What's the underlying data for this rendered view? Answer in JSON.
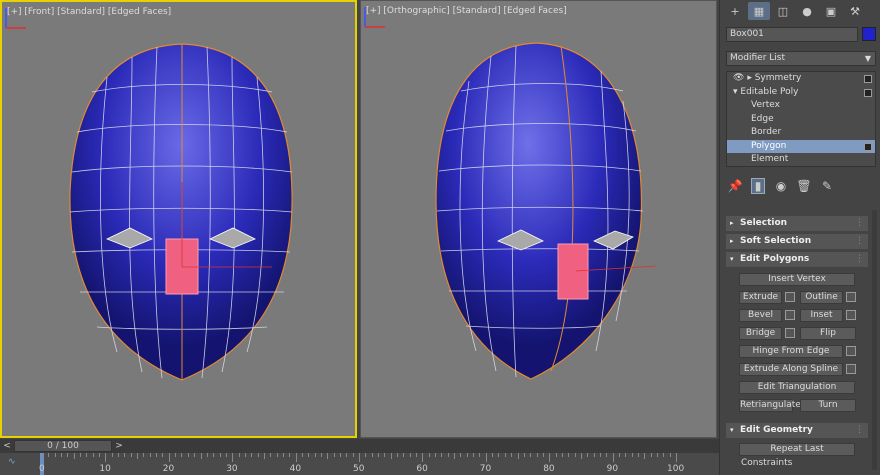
{
  "viewports": {
    "front": {
      "label": "[+] [Front] [Standard] [Edged Faces]"
    },
    "ortho": {
      "label": "[+] [Orthographic] [Standard] [Edged Faces]"
    }
  },
  "axis": {
    "z": "z",
    "x": "x"
  },
  "command_panel": {
    "tabs": [
      "create-icon",
      "modify-icon",
      "hierarchy-icon",
      "motion-icon",
      "display-icon",
      "utilities-icon"
    ],
    "object_name": "Box001",
    "object_color": "#2222cc",
    "modifier_list": "Modifier List",
    "stack": [
      {
        "label": "Symmetry"
      },
      {
        "label": "Editable Poly"
      },
      {
        "label": "Vertex"
      },
      {
        "label": "Edge"
      },
      {
        "label": "Border"
      },
      {
        "label": "Polygon"
      },
      {
        "label": "Element"
      }
    ],
    "rollouts": {
      "selection": "Selection",
      "soft_selection": "Soft Selection",
      "edit_polygons": "Edit Polygons",
      "edit_geometry": "Edit Geometry"
    },
    "buttons": {
      "insert_vertex": "Insert Vertex",
      "extrude": "Extrude",
      "outline": "Outline",
      "bevel": "Bevel",
      "inset": "Inset",
      "bridge": "Bridge",
      "flip": "Flip",
      "hinge_from_edge": "Hinge From Edge",
      "extrude_along_spline": "Extrude Along Spline",
      "edit_triangulation": "Edit Triangulation",
      "retriangulate": "Retriangulate",
      "turn": "Turn",
      "repeat_last": "Repeat Last",
      "constraints": "Constraints"
    }
  },
  "timeline": {
    "slider_text": "0 / 100",
    "prev": "<",
    "next": ">",
    "ticks": [
      "0",
      "10",
      "20",
      "30",
      "40",
      "50",
      "60",
      "70",
      "80",
      "90",
      "100"
    ]
  }
}
